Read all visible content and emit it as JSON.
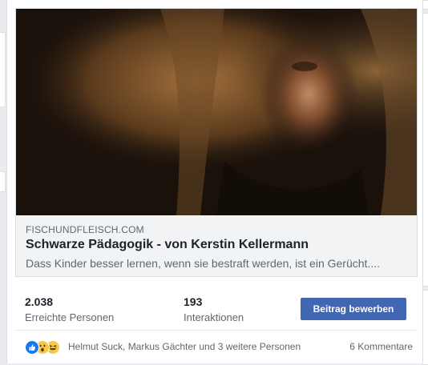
{
  "post": {
    "link_preview": {
      "domain": "FISCHUNDFLEISCH.COM",
      "title": "Schwarze Pädagogik - von Kerstin Kellermann",
      "description": "Dass Kinder besser lernen, wenn sie bestraft werden, ist ein Gerücht...."
    },
    "stats": {
      "reach_value": "2.038",
      "reach_label": "Erreichte Personen",
      "interactions_value": "193",
      "interactions_label": "Interaktionen"
    },
    "boost_button_label": "Beitrag bewerben",
    "reactions": {
      "icons": [
        "like-reaction-icon",
        "wow-reaction-icon",
        "haha-reaction-icon"
      ],
      "names": "Helmut Suck, Markus Gächter und 3 weitere Personen",
      "comments": "6 Kommentare"
    }
  },
  "colors": {
    "accent": "#4267b2",
    "like": "#1877f2",
    "emoji_yellow": "#f7c94b"
  }
}
